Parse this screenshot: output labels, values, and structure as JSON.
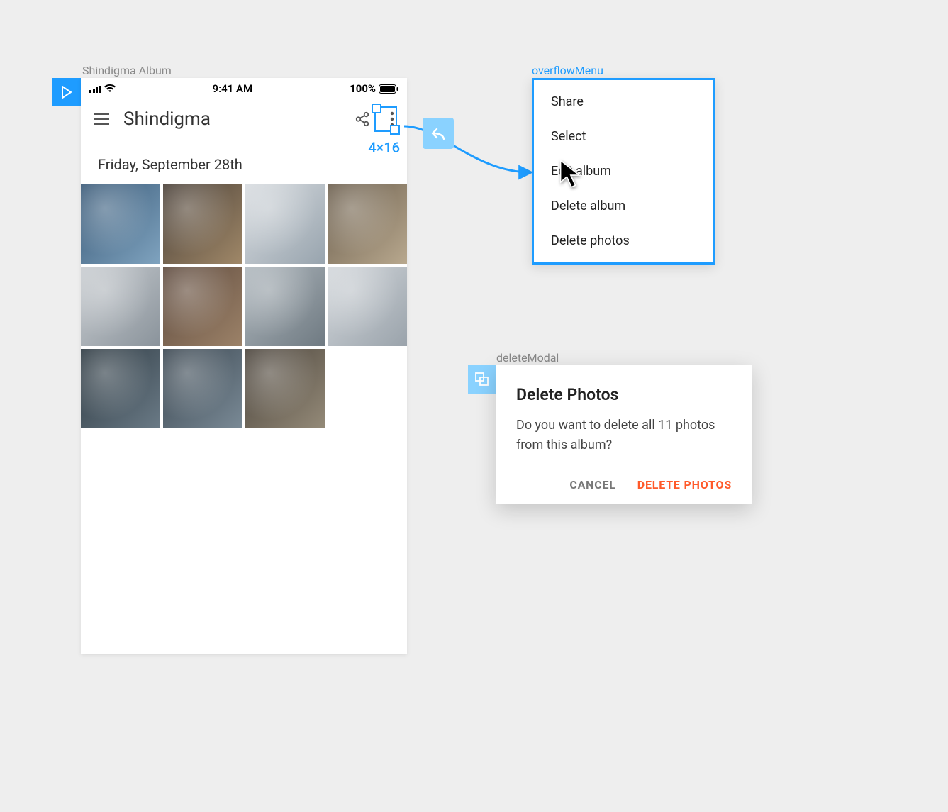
{
  "labels": {
    "phone_frame": "Shindigma Album",
    "overflow_frame": "overflowMenu",
    "modal_frame": "deleteModal"
  },
  "status": {
    "time": "9:41 AM",
    "battery": "100%"
  },
  "app": {
    "title": "Shindigma",
    "date_header": "Friday, September 28th",
    "selection_dimensions": "4×16"
  },
  "menu": {
    "items": [
      "Share",
      "Select",
      "Edit album",
      "Delete album",
      "Delete photos"
    ]
  },
  "modal": {
    "title": "Delete Photos",
    "body": "Do you want to delete all 11 photos from this album?",
    "cancel": "Cancel",
    "confirm": "Delete Photos"
  }
}
